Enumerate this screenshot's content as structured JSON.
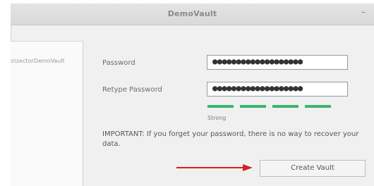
{
  "window": {
    "title": "DemoVault",
    "minimize_glyph": "–"
  },
  "sidebar": {
    "path_text": "ts\\sectorDemoVault"
  },
  "form": {
    "password_label": "Password",
    "password_value": "●●●●●●●●●●●●●●●●●●●",
    "retype_label": "Retype Password",
    "retype_value": "●●●●●●●●●●●●●●●●●●●",
    "strength_label": "Strong",
    "strength_level_segments": 4,
    "strength_total_segments": 4,
    "strength_color": "#3cb371",
    "important_text": "IMPORTANT: If you forget your password, there is no way to recover your data.",
    "create_button_label": "Create Vault"
  },
  "annotation": {
    "arrow_color": "#d62020",
    "arrow_icon": "red-arrow-right-icon"
  }
}
